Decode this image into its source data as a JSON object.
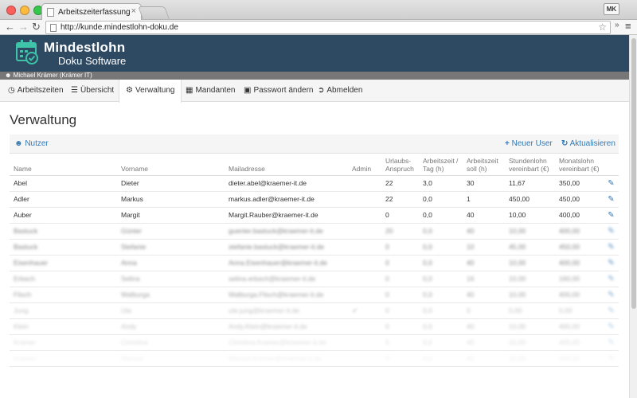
{
  "browser": {
    "tab_title": "Arbeitszeiterfassung",
    "url": "http://kunde.mindestlohn-doku.de",
    "profile": "MK"
  },
  "app": {
    "brand_title": "Mindestlohn",
    "brand_subtitle": "Doku Software",
    "user": "Michael Krämer (Krämer IT)"
  },
  "nav": [
    {
      "label": "Arbeitszeiten",
      "icon": "clock-icon"
    },
    {
      "label": "Übersicht",
      "icon": "list-icon"
    },
    {
      "label": "Verwaltung",
      "icon": "gears-icon",
      "active": true
    },
    {
      "label": "Mandanten",
      "icon": "book-icon"
    },
    {
      "label": "Passwort ändern",
      "icon": "lock-icon"
    },
    {
      "label": "Abmelden",
      "icon": "sign-out-icon"
    }
  ],
  "page": {
    "title": "Verwaltung",
    "panel_title": "Nutzer",
    "new_user_label": "Neuer User",
    "refresh_label": "Aktualisieren"
  },
  "table": {
    "headers": [
      "Name",
      "Vorname",
      "Mailadresse",
      "Admin",
      "Urlaubs-Anspruch",
      "Arbeitszeit / Tag (h)",
      "Arbeitszeit soll (h)",
      "Stundenlohn vereinbart (€)",
      "Monatslohn vereinbart (€)"
    ],
    "rows": [
      [
        "Abel",
        "Dieter",
        "dieter.abel@kraemer-it.de",
        "",
        "22",
        "3,0",
        "30",
        "11,67",
        "350,00"
      ],
      [
        "Adler",
        "Markus",
        "markus.adler@kraemer-it.de",
        "",
        "22",
        "0,0",
        "1",
        "450,00",
        "450,00"
      ],
      [
        "Auber",
        "Margit",
        "Margit.Rauber@kraemer-it.de",
        "",
        "0",
        "0,0",
        "40",
        "10,00",
        "400,00"
      ],
      [
        "Bastuck",
        "Günter",
        "guenter.bastuck@kraemer-it.de",
        "",
        "20",
        "0,0",
        "40",
        "10,00",
        "400,00"
      ],
      [
        "Bastuck",
        "Stefanie",
        "stefanie.bastuck@kraemer-it.de",
        "",
        "0",
        "0,0",
        "10",
        "45,00",
        "450,00"
      ],
      [
        "Eisenhauer",
        "Anna",
        "Anna.Eisenhauer@kraemer-it.de",
        "",
        "0",
        "0,0",
        "40",
        "10,00",
        "400,00"
      ],
      [
        "Erbach",
        "Selina",
        "selina.erbach@kraemer-it.de",
        "",
        "0",
        "0,0",
        "16",
        "10,00",
        "160,00"
      ],
      [
        "Flisch",
        "Walburga",
        "Walburga.Flisch@kraemer-it.de",
        "",
        "0",
        "0,0",
        "40",
        "10,00",
        "400,00"
      ],
      [
        "Jung",
        "Ute",
        "ute.jung@kraemer-it.de",
        "✔",
        "0",
        "0,0",
        "0",
        "0,00",
        "0,00"
      ],
      [
        "Klein",
        "Andy",
        "Andy.Klein@kraemer-it.de",
        "",
        "0",
        "0,0",
        "40",
        "10,00",
        "400,00"
      ],
      [
        "Kramer",
        "Christina",
        "Christina.Kramer@kraemer-it.de",
        "",
        "0",
        "0,0",
        "40",
        "10,00",
        "400,00"
      ],
      [
        "Kramer",
        "Manuel",
        "Manuel.Kramer@kraemer-it.de",
        "",
        "0",
        "0,0",
        "40",
        "10,00",
        "400,00"
      ]
    ]
  }
}
